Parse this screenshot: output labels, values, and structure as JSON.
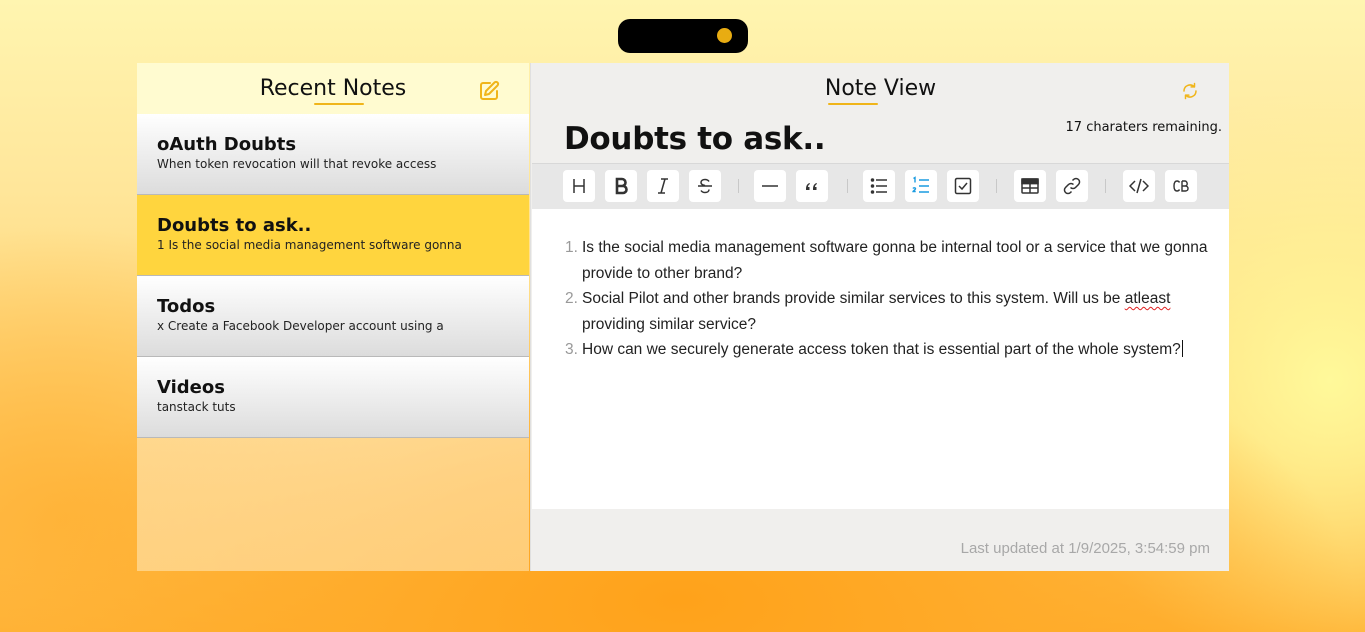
{
  "sidebar": {
    "title": "Recent Notes",
    "new_note_icon": "edit-square-icon",
    "notes": [
      {
        "title": "oAuth Doubts",
        "preview": "When token revocation will that revoke access",
        "active": false
      },
      {
        "title": "Doubts to ask..",
        "preview": "1 Is the social media management software gonna",
        "active": true
      },
      {
        "title": "Todos",
        "preview": "x Create a Facebook Developer account using a",
        "active": false
      },
      {
        "title": "Videos",
        "preview": "tanstack tuts",
        "active": false
      }
    ]
  },
  "main": {
    "title": "Note View",
    "refresh_icon": "refresh-icon",
    "chars_remaining": "17 charaters remaining.",
    "note_title": "Doubts to ask..",
    "toolbar": [
      "heading",
      "bold",
      "italic",
      "strikethrough",
      "horizontal-rule",
      "quote",
      "bullet-list",
      "ordered-list",
      "checklist",
      "table",
      "link",
      "code",
      "code-block"
    ],
    "list": [
      {
        "num": "1.",
        "pre": "Is the social media management software gonna be internal tool or a service that we gonna provide to other brand?",
        "misspelled": "",
        "post": ""
      },
      {
        "num": "2.",
        "pre": "Social Pilot and other brands provide similar services to this system. Will us be ",
        "misspelled": "atleast",
        "post": " providing similar service?"
      },
      {
        "num": "3.",
        "pre": "How can we securely generate access token that is essential part of the whole system?",
        "misspelled": "",
        "post": ""
      }
    ],
    "last_updated": "Last updated at 1/9/2025, 3:54:59 pm"
  },
  "colors": {
    "accent": "#f0b51a",
    "active_note": "#ffd53e",
    "ordered_list_active": "#1a9be0"
  }
}
